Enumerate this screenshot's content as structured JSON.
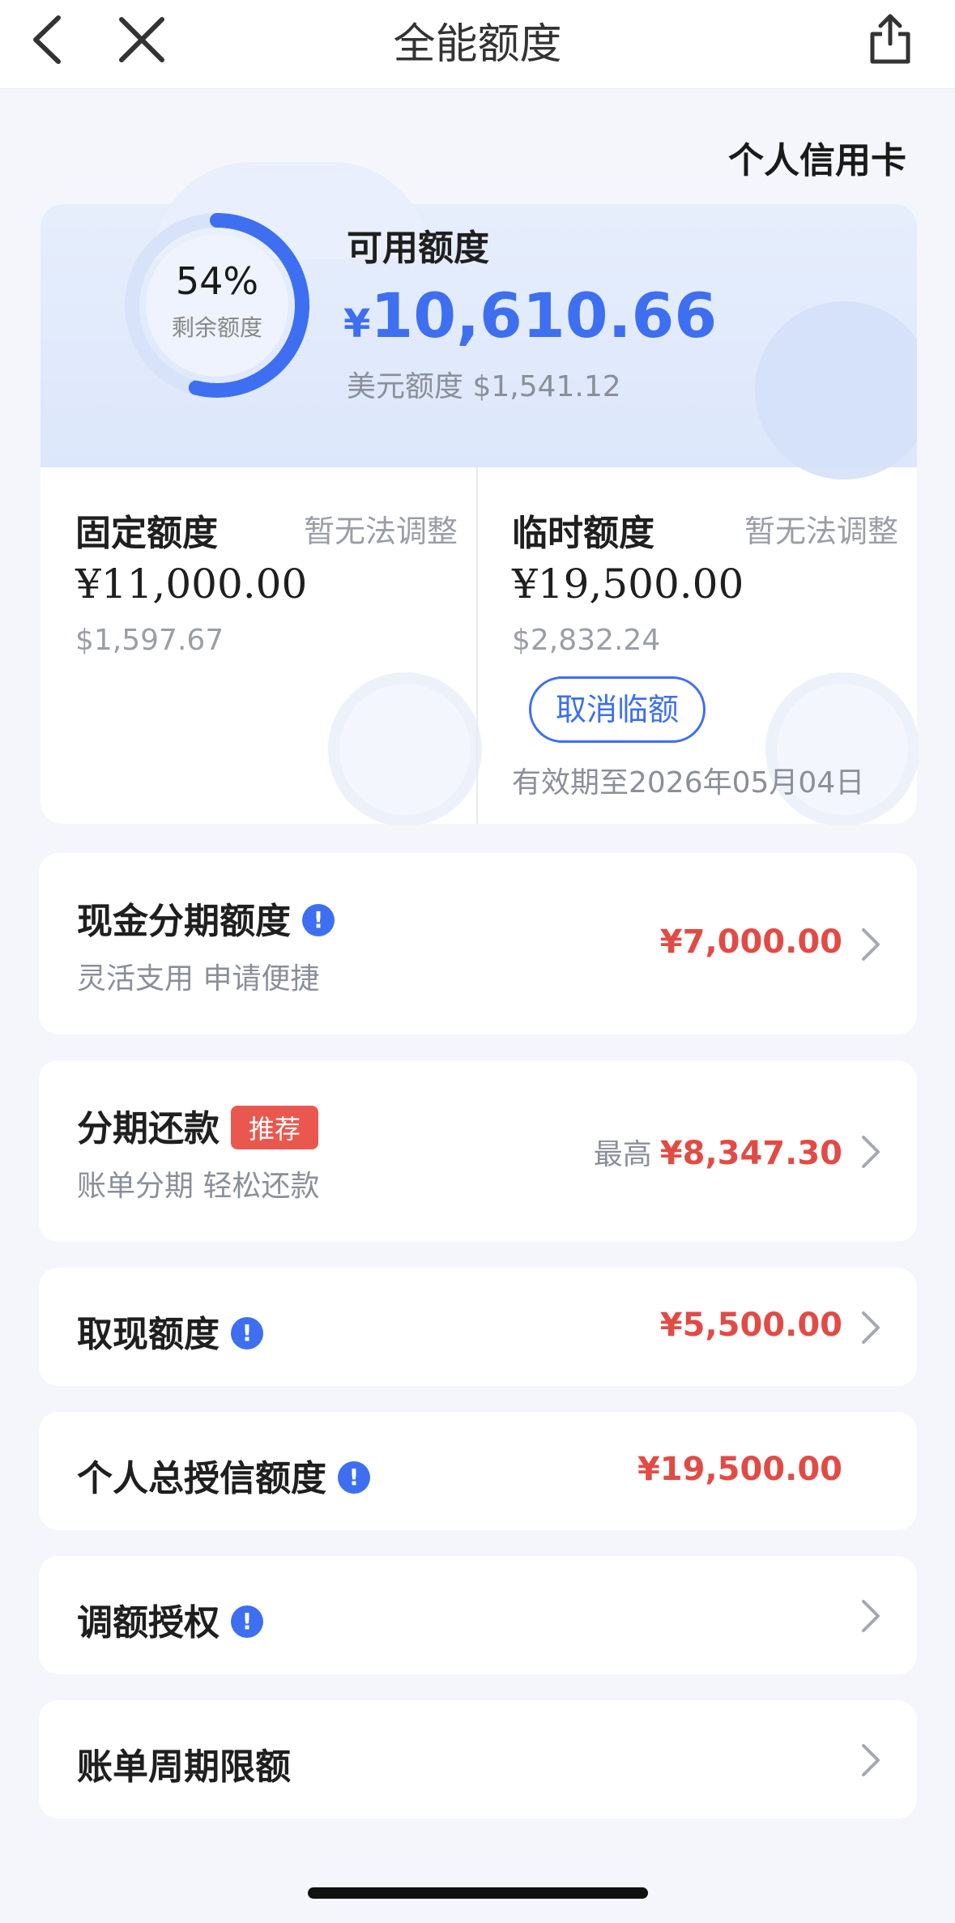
{
  "nav": {
    "title": "全能额度",
    "back_icon": "chevron-left-icon",
    "close_icon": "close-icon",
    "share_icon": "share-icon"
  },
  "card_type": "个人信用卡",
  "summary": {
    "remaining_percent_text": "54%",
    "remaining_percent": 54,
    "remaining_label": "剩余额度",
    "available_label": "可用额度",
    "available_currency": "¥",
    "available_amount": "10,610.66",
    "usd_label": "美元额度",
    "usd_amount": "$1,541.12"
  },
  "fixed": {
    "label": "固定额度",
    "note": "暂无法调整",
    "cny": "¥11,000.00",
    "usd": "$1,597.67"
  },
  "temporary": {
    "label": "临时额度",
    "note": "暂无法调整",
    "cny": "¥19,500.00",
    "usd": "$2,832.24",
    "cancel_button": "取消临额",
    "valid_until": "有效期至2026年05月04日"
  },
  "rows": {
    "cash_installment": {
      "title": "现金分期额度",
      "subtitle": "灵活支用 申请便捷",
      "amount": "¥7,000.00"
    },
    "installment_repay": {
      "title": "分期还款",
      "tag": "推荐",
      "subtitle": "账单分期 轻松还款",
      "prefix": "最高",
      "amount": "¥8,347.30"
    },
    "cash_withdraw": {
      "title": "取现额度",
      "amount": "¥5,500.00"
    },
    "total_credit": {
      "title": "个人总授信额度",
      "amount": "¥19,500.00"
    },
    "adjust_auth": {
      "title": "调额授权"
    },
    "bill_cycle_limit": {
      "title": "账单周期限额"
    }
  },
  "colors": {
    "accent": "#3e6ff0",
    "amount_red": "#e24b45",
    "tag_red": "#e9584f",
    "background": "#f4f6fb"
  }
}
